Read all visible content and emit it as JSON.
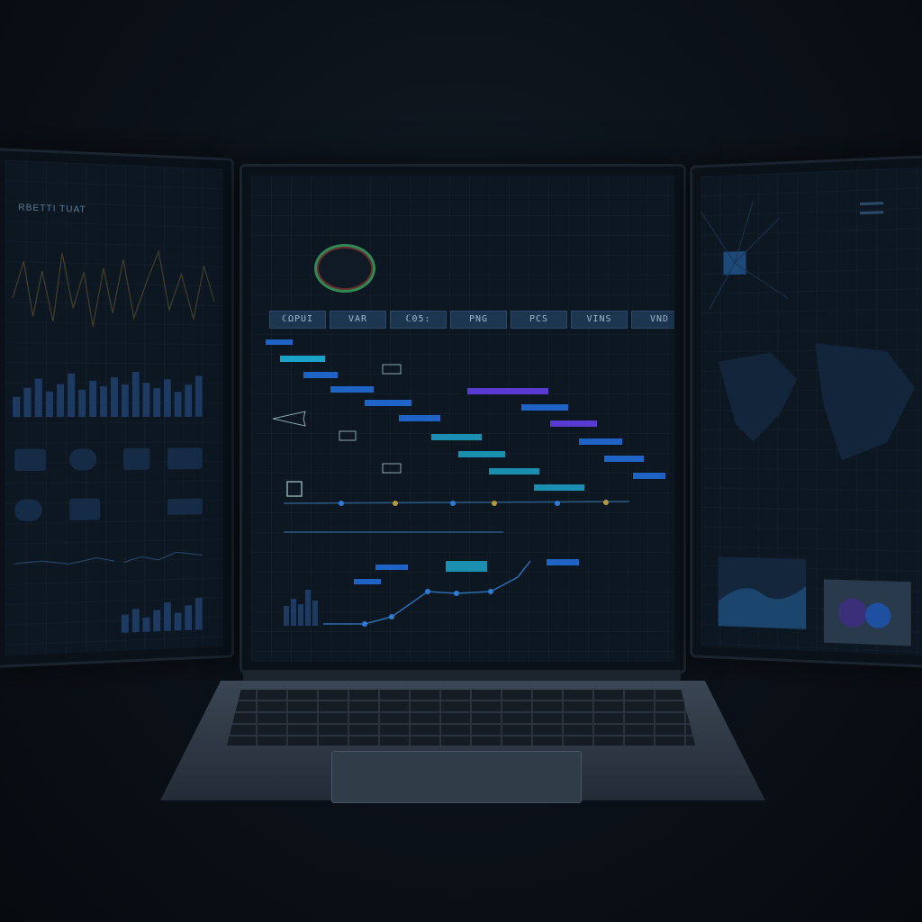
{
  "left_panel": {
    "title": "RBETTI TUAT"
  },
  "center_panel": {
    "tabs": [
      {
        "label": "ℂΩPUI"
      },
      {
        "label": "VAR"
      },
      {
        "label": "ℂ05:"
      },
      {
        "label": "PNG"
      },
      {
        "label": "PCS"
      },
      {
        "label": "VINS"
      },
      {
        "label": "VND"
      }
    ]
  },
  "colors": {
    "accent_cyan": "#1aa3c8",
    "accent_blue": "#1f63c7",
    "accent_purple": "#5a3bd1",
    "knob_ring": "#2f8a55"
  }
}
